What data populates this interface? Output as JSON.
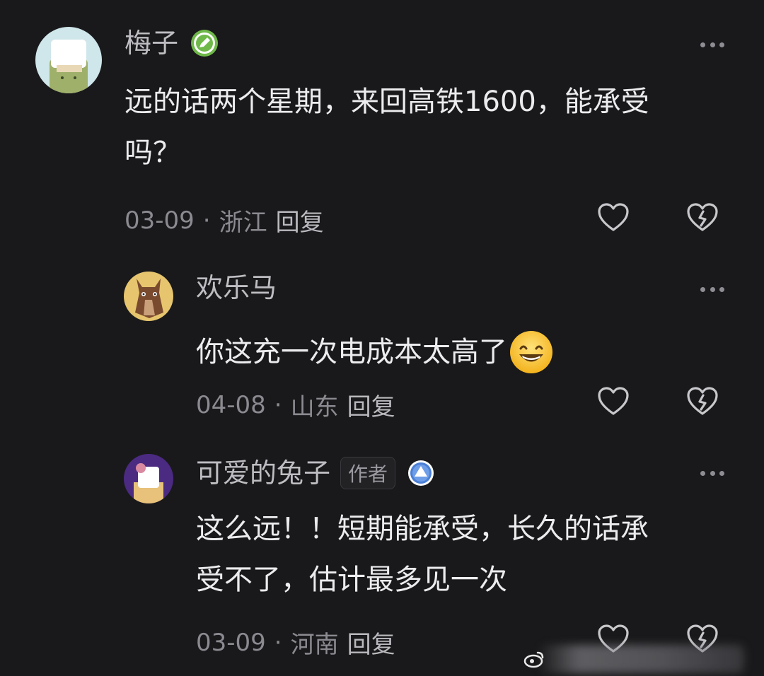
{
  "comments": [
    {
      "username": "梅子",
      "badge_icon": "pencil-badge-icon",
      "text_lines": [
        "远的话两个星期，来回高铁1600，能承受",
        "吗？"
      ],
      "date": "03-09",
      "location": "浙江",
      "reply_label": "回复"
    },
    {
      "username": "欢乐马",
      "text": "你这充一次电成本太高了",
      "emoji": "grinning-face-emoji",
      "date": "04-08",
      "location": "山东",
      "reply_label": "回复"
    },
    {
      "username": "可爱的兔子",
      "author_tag": "作者",
      "badge_icon": "up-arrow-badge-icon",
      "text_lines": [
        "这么远！！短期能承受，长久的话承",
        "受不了，估计最多见一次"
      ],
      "date": "03-09",
      "location": "河南",
      "reply_label": "回复"
    }
  ],
  "separator": "·",
  "colors": {
    "background": "#19191b",
    "username": "#bdbdc2",
    "body_text": "#ececee",
    "meta": "#8a8a90",
    "green_badge": "#6fb94a",
    "blue_badge": "#4a7fd6"
  }
}
